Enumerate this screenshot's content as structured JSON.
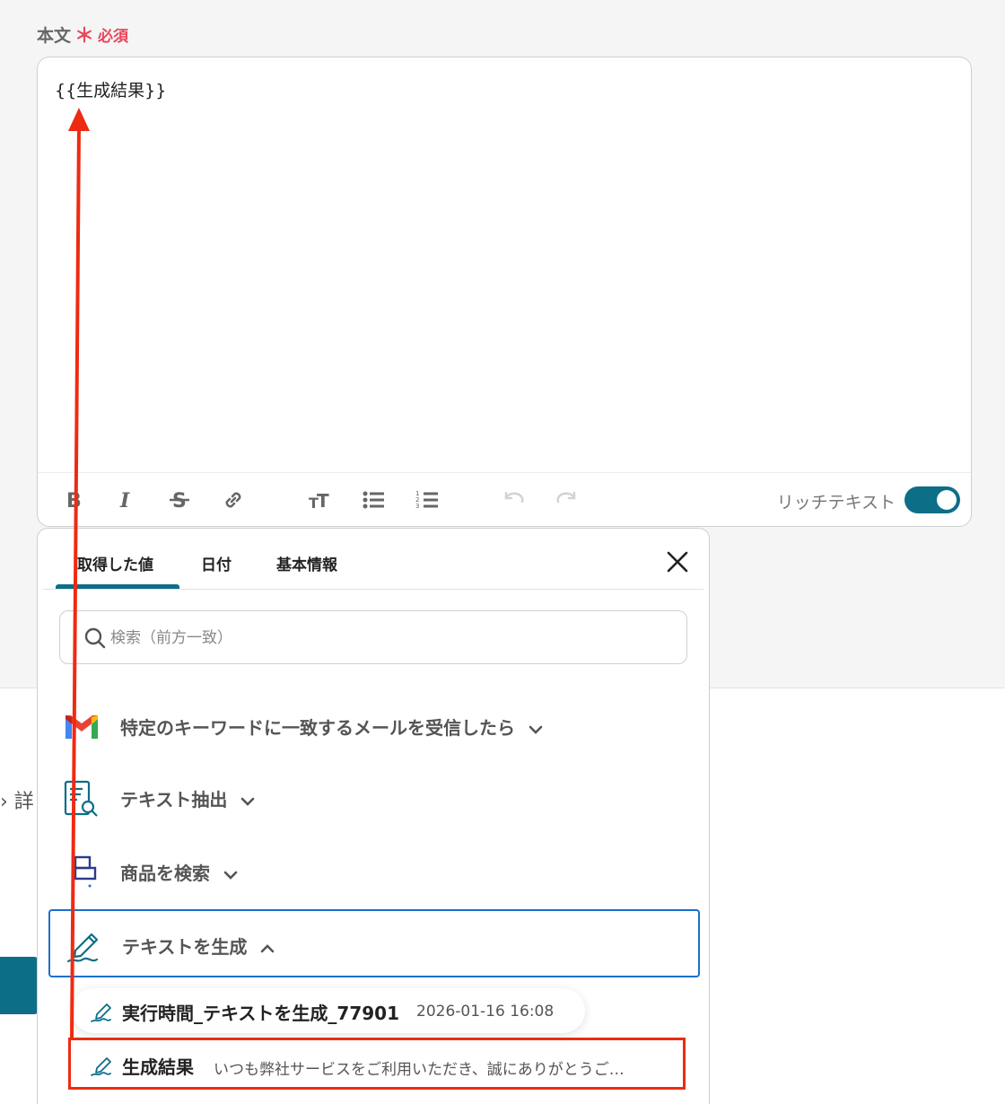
{
  "field": {
    "label": "本文",
    "required_star": "＊",
    "required_text": "必須",
    "editor_content": "{{生成結果}}"
  },
  "toolbar": {
    "rich_text_label": "リッチテキスト",
    "rich_text_enabled": true
  },
  "side": {
    "detail_text": "› 詳"
  },
  "popup": {
    "tabs": [
      {
        "label": "取得した値",
        "active": true
      },
      {
        "label": "日付",
        "active": false
      },
      {
        "label": "基本情報",
        "active": false
      }
    ],
    "search_placeholder": "検索（前方一致）",
    "groups": [
      {
        "title": "特定のキーワードに一致するメールを受信したら",
        "icon": "gmail-icon",
        "expanded": false
      },
      {
        "title": "テキスト抽出",
        "icon": "document-search-icon",
        "expanded": false
      },
      {
        "title": "商品を検索",
        "icon": "database-icon",
        "expanded": false
      },
      {
        "title": "テキストを生成",
        "icon": "pen-icon",
        "expanded": true
      }
    ],
    "items": [
      {
        "name": "実行時間_テキストを生成_77901",
        "value": "2026-01-16 16:08",
        "icon": "pen-icon"
      },
      {
        "name": "生成結果",
        "value": "いつも弊社サービスをご利用いただき、誠にありがとうご…",
        "icon": "pen-icon"
      }
    ]
  },
  "colors": {
    "accent": "#0d6e88",
    "required": "#e8475c",
    "annotation": "#ee2b12",
    "active_border": "#1a6fcf"
  }
}
